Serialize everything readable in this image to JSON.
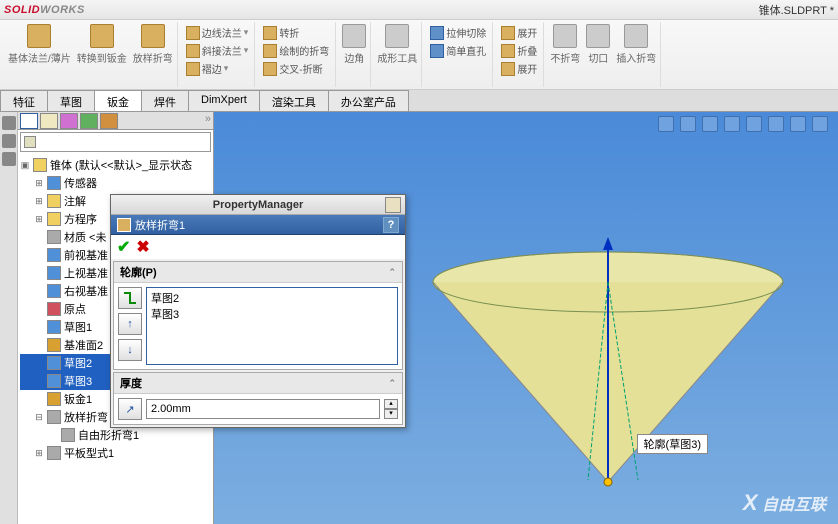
{
  "app": {
    "logo1": "SOLID",
    "logo2": "WORKS",
    "doc": "锥体.SLDPRT *"
  },
  "ribbon": {
    "big": [
      {
        "label": "基体法兰/薄片"
      },
      {
        "label": "转换到钣金"
      },
      {
        "label": "放样折弯"
      }
    ],
    "col1": [
      "边线法兰",
      "斜接法兰",
      "褶边"
    ],
    "col2": [
      "转折",
      "绘制的折弯",
      "交叉-折断"
    ],
    "mid": [
      "边角"
    ],
    "mid2": [
      "成形工具"
    ],
    "col3": [
      "拉伸切除",
      "简单直孔",
      ""
    ],
    "col4": [
      "展开",
      "折叠",
      "展开"
    ],
    "big2": [
      {
        "label": "不折弯"
      },
      {
        "label": "切口"
      },
      {
        "label": "插入折弯"
      }
    ]
  },
  "tabs": [
    "特征",
    "草图",
    "钣金",
    "焊件",
    "DimXpert",
    "渲染工具",
    "办公室产品"
  ],
  "tree": {
    "root": "锥体  (默认<<默认>_显示状态",
    "items": [
      {
        "icon": "b",
        "label": "传感器"
      },
      {
        "icon": "y",
        "label": "注解"
      },
      {
        "icon": "y",
        "label": "方程序"
      },
      {
        "icon": "gr",
        "label": "材质 <未"
      },
      {
        "icon": "b",
        "label": "前视基准"
      },
      {
        "icon": "b",
        "label": "上视基准"
      },
      {
        "icon": "b",
        "label": "右视基准"
      },
      {
        "icon": "r",
        "label": "原点"
      },
      {
        "icon": "b",
        "label": "草图1"
      },
      {
        "icon": "o",
        "label": "基准面2"
      },
      {
        "icon": "b",
        "label": "草图2",
        "sel": true
      },
      {
        "icon": "b",
        "label": "草图3",
        "sel": true
      },
      {
        "icon": "o",
        "label": "钣金1"
      },
      {
        "icon": "gr",
        "label": "放样折弯"
      },
      {
        "icon": "gr",
        "label": "自由形折弯1",
        "l": 2
      },
      {
        "icon": "gr",
        "label": "平板型式1"
      }
    ]
  },
  "pm": {
    "title": "PropertyManager",
    "header": "放样折弯1",
    "help": "?",
    "section1": "轮廓(P)",
    "profiles": [
      "草图2",
      "草图3"
    ],
    "section2": "厚度",
    "thickness": "2.00mm"
  },
  "viewport": {
    "sketch_label": "轮廓(草图3)",
    "watermark": "自由互联"
  }
}
